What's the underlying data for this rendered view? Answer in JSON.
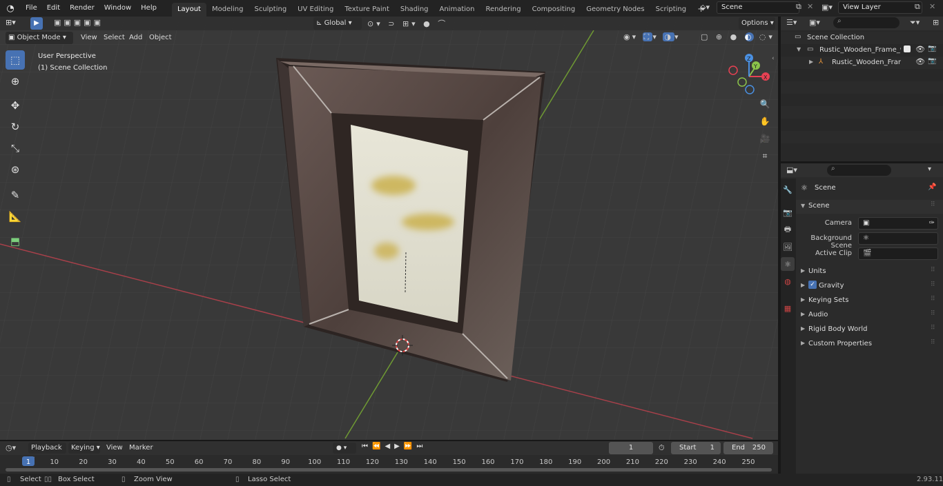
{
  "topbar": {
    "menus": [
      "File",
      "Edit",
      "Render",
      "Window",
      "Help"
    ],
    "workspaces": [
      "Layout",
      "Modeling",
      "Sculpting",
      "UV Editing",
      "Texture Paint",
      "Shading",
      "Animation",
      "Rendering",
      "Compositing",
      "Geometry Nodes",
      "Scripting"
    ],
    "active_workspace": "Layout",
    "add_tab_label": "+",
    "scene_name": "Scene",
    "view_layer_name": "View Layer"
  },
  "viewport_header": {
    "mode": "Object Mode",
    "menus": [
      "View",
      "Select",
      "Add",
      "Object"
    ],
    "transform_orientation": "Global",
    "options_label": "Options"
  },
  "viewport": {
    "perspective_label": "User Perspective",
    "collection_label": "(1) Scene Collection",
    "gizmo_axes": [
      "X",
      "Y",
      "Z"
    ]
  },
  "outliner": {
    "root": "Scene Collection",
    "items": [
      {
        "name": "Rustic_Wooden_Frame_with_"
      },
      {
        "name": "Rustic_Wooden_Frame_v"
      }
    ]
  },
  "properties": {
    "context_title": "Scene",
    "section_title": "Scene",
    "fields": [
      {
        "label": "Camera"
      },
      {
        "label": "Background Scene"
      },
      {
        "label": "Active Clip"
      }
    ],
    "panels": [
      "Units",
      "Gravity",
      "Keying Sets",
      "Audio",
      "Rigid Body World",
      "Custom Properties"
    ],
    "gravity_checked": true
  },
  "timeline": {
    "menus": [
      "Playback",
      "Keying",
      "View",
      "Marker"
    ],
    "current_frame": "1",
    "start_label": "Start",
    "start_value": "1",
    "end_label": "End",
    "end_value": "250",
    "ticks": [
      "1",
      "10",
      "20",
      "30",
      "40",
      "50",
      "60",
      "70",
      "80",
      "90",
      "100",
      "110",
      "120",
      "130",
      "140",
      "150",
      "160",
      "170",
      "180",
      "190",
      "200",
      "210",
      "220",
      "230",
      "240",
      "250"
    ]
  },
  "statusbar": {
    "select": "Select",
    "box_select": "Box Select",
    "zoom_view": "Zoom View",
    "lasso_select": "Lasso Select",
    "version": "2.93.11"
  },
  "colors": {
    "accent": "#4772b3",
    "x_axis": "#e74153",
    "y_axis": "#8bc34a",
    "z_axis": "#4a90e2"
  }
}
